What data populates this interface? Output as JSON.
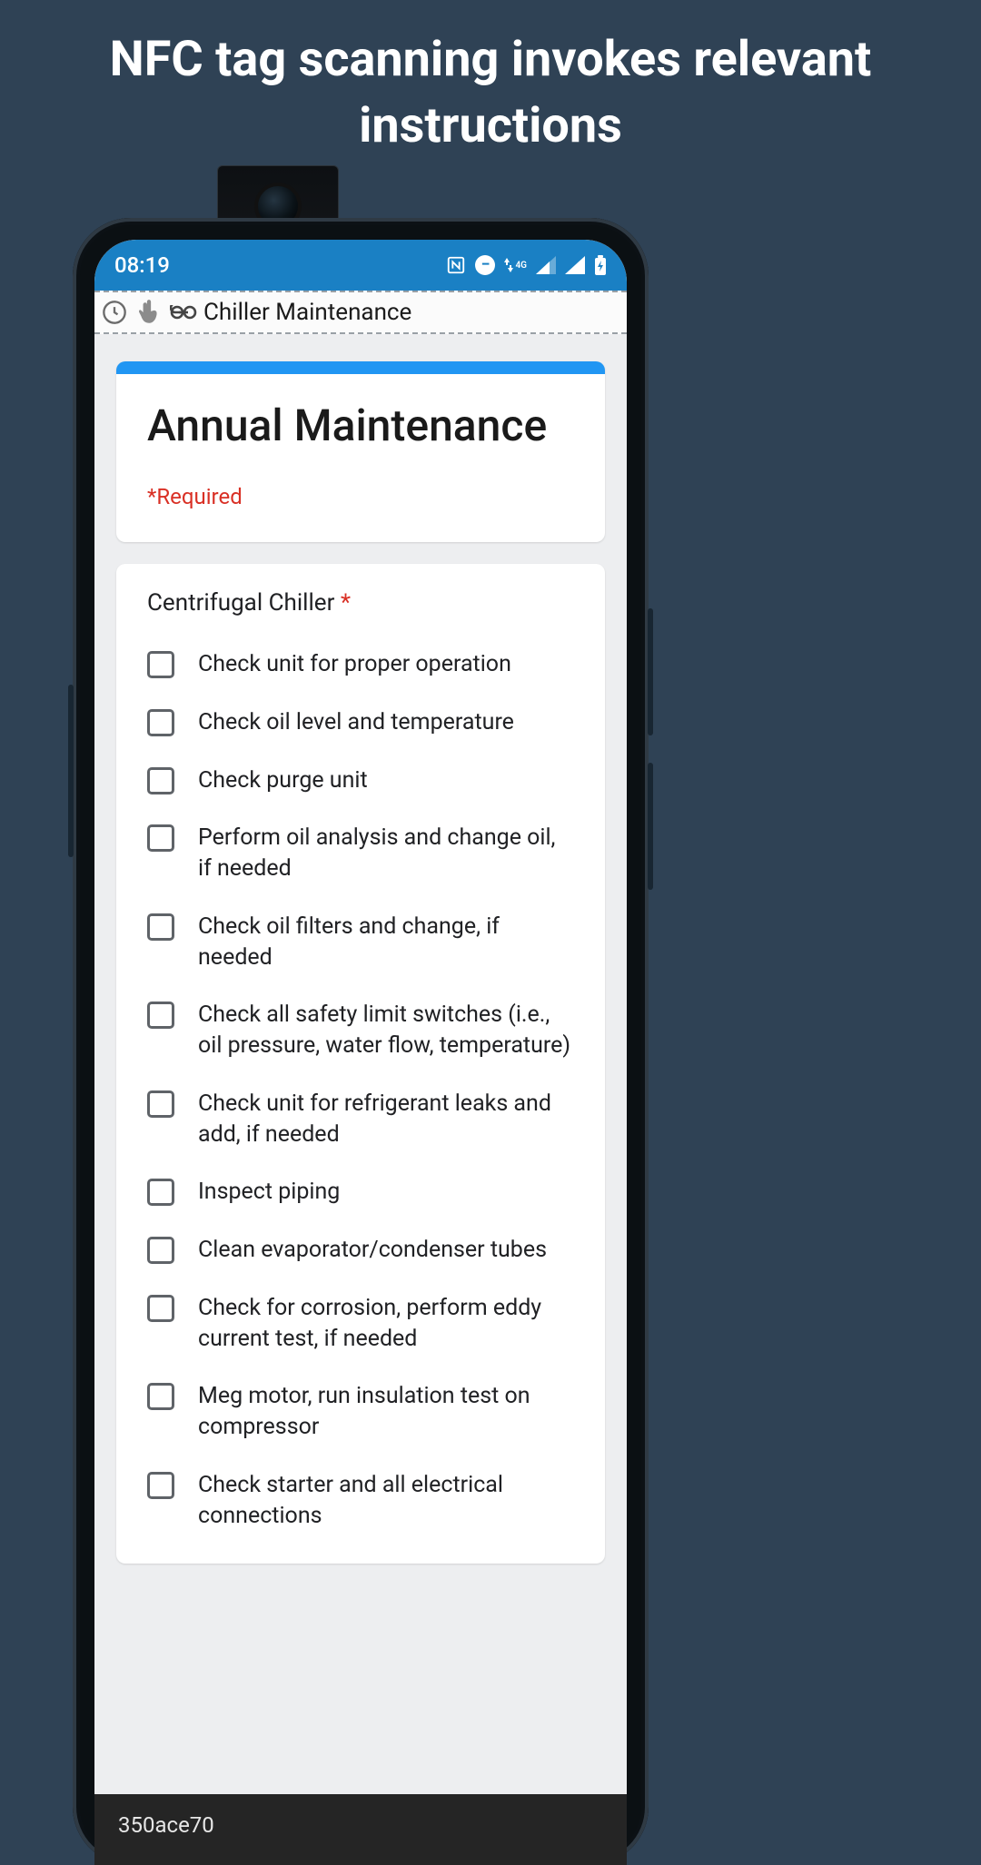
{
  "headline": "NFC tag scanning invokes relevant instructions",
  "status": {
    "time": "08:19",
    "network_label": "4G"
  },
  "topbar": {
    "title": "Chiller Maintenance"
  },
  "form": {
    "title": "Annual Maintenance",
    "required_note": "*Required",
    "section_title": "Centrifugal Chiller",
    "items": [
      "Check unit for proper operation",
      "Check oil level and temperature",
      "Check purge unit",
      "Perform oil analysis and change oil, if needed",
      "Check oil filters and change, if needed",
      "Check all safety limit switches (i.e., oil pressure, water flow, temperature)",
      "Check unit for refrigerant leaks and add, if needed",
      "Inspect piping",
      "Clean evaporator/condenser tubes",
      "Check for corrosion, perform eddy current test, if needed",
      "Meg motor, run insulation test on compressor",
      "Check starter and all electrical connections"
    ]
  },
  "toast": {
    "text": "350ace70"
  }
}
